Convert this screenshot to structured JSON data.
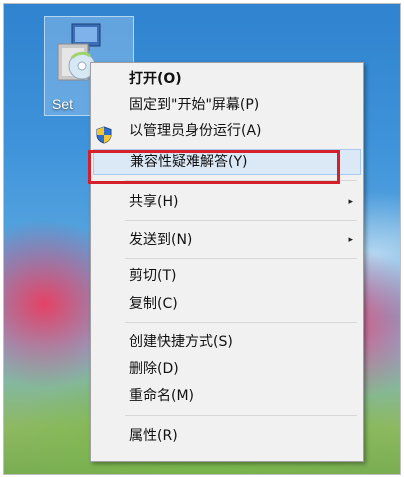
{
  "desktop_icon": {
    "label": "Set",
    "icon": "setup-installer-icon"
  },
  "context_menu": {
    "items": [
      {
        "label": "打开(O)",
        "bold": true
      },
      {
        "label": "固定到\"开始\"屏幕(P)"
      },
      {
        "label": "以管理员身份运行(A)",
        "icon": "uac-shield-icon"
      },
      {
        "label": "兼容性疑难解答(Y)",
        "highlighted": true
      },
      {
        "label": "共享(H)",
        "submenu": true
      },
      {
        "label": "发送到(N)",
        "submenu": true
      },
      {
        "label": "剪切(T)"
      },
      {
        "label": "复制(C)"
      },
      {
        "label": "创建快捷方式(S)"
      },
      {
        "label": "删除(D)"
      },
      {
        "label": "重命名(M)"
      },
      {
        "label": "属性(R)"
      }
    ],
    "submenu_arrow": "▸"
  },
  "colors": {
    "highlight_bg": "#dbe9f7",
    "annotation_border": "#d4202a"
  }
}
